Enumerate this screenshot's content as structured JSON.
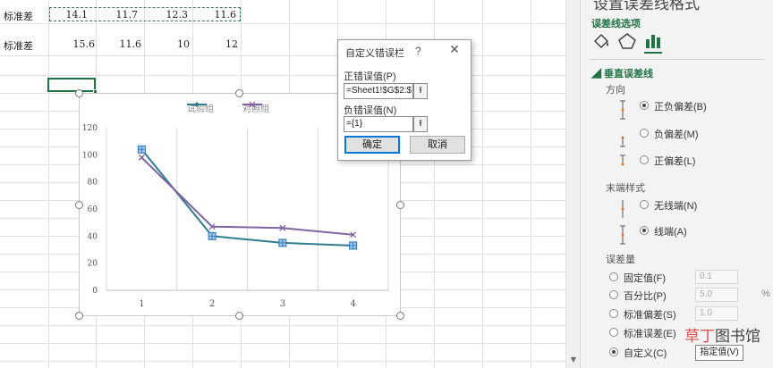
{
  "sheet": {
    "rows": [
      {
        "label": "标准差",
        "values": [
          "14.1",
          "11.7",
          "12.3",
          "11.6"
        ]
      },
      {
        "label": "标准差",
        "values": [
          "15.6",
          "11.6",
          "10",
          "12"
        ]
      }
    ]
  },
  "chart_data": {
    "type": "line",
    "categories": [
      "1",
      "2",
      "3",
      "4"
    ],
    "series": [
      {
        "name": "试验组",
        "values": [
          104,
          40,
          35,
          33
        ],
        "color": "#2e7d8e"
      },
      {
        "name": "对照组",
        "values": [
          98,
          47,
          46,
          41
        ],
        "color": "#8064a2"
      }
    ],
    "ylim": [
      0,
      120
    ],
    "yticks": [
      "0",
      "20",
      "40",
      "60",
      "80",
      "100",
      "120"
    ],
    "grid": "vertical",
    "legend": "top"
  },
  "dialog": {
    "title": "自定义错误栏",
    "help": "?",
    "close": "✕",
    "positive_label": "正错误值(P)",
    "positive_value": "=Sheet1!$G$2:$",
    "negative_label": "负错误值(N)",
    "negative_value": "={1}",
    "ok": "确定",
    "cancel": "取消"
  },
  "pane": {
    "title": "设置误差线格式",
    "options": "误差线选项",
    "section": "◢ 垂直误差线",
    "direction_label": "方向",
    "directions": [
      "正负偏差(B)",
      "负偏差(M)",
      "正偏差(L)"
    ],
    "end_style_label": "末端样式",
    "end_styles": [
      "无线端(N)",
      "线端(A)"
    ],
    "amount_label": "误差量",
    "amounts": [
      "固定值(F)",
      "百分比(P)",
      "标准偏差(S)",
      "标准误差(E)",
      "自定义(C)"
    ],
    "fixed_value": "0.1",
    "percent_value": "5.0",
    "stddev_value": "1.0",
    "percent_unit": "%",
    "specify_button": "指定值(V)",
    "accent": "#217346"
  },
  "watermark": {
    "part1": "草丁",
    "part2": "图书馆"
  }
}
